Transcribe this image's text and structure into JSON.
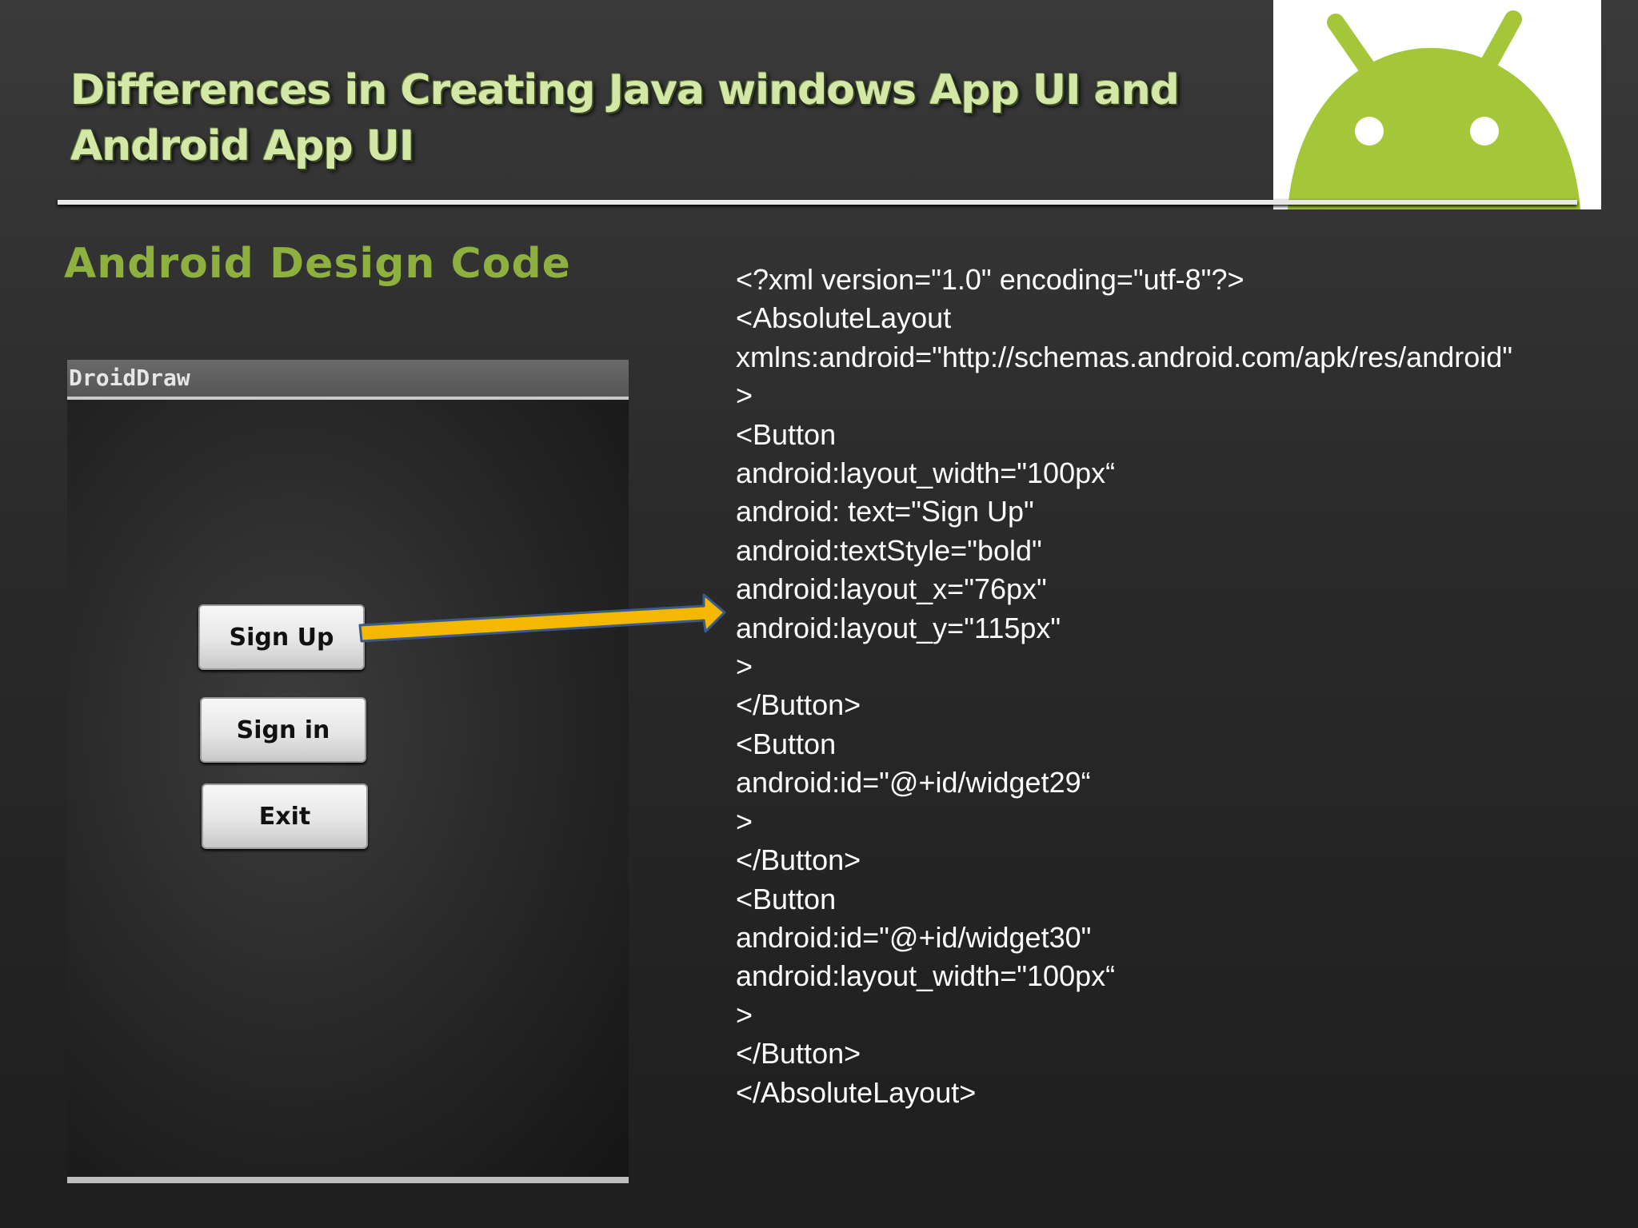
{
  "slide": {
    "title": "Differences in Creating  Java windows App UI and Android App UI",
    "section_heading": "Android Design Code",
    "brand_color": "#8db03f"
  },
  "droiddraw": {
    "window_title": "DroidDraw",
    "buttons": [
      {
        "label": "Sign Up"
      },
      {
        "label": "Sign in"
      },
      {
        "label": "Exit"
      }
    ]
  },
  "arrow": {
    "color": "#f5b800",
    "icon": "arrow-right-icon"
  },
  "code": {
    "lines": [
      "<?xml version=\"1.0\" encoding=\"utf-8\"?>",
      "<AbsoluteLayout",
      "xmlns:android=\"http://schemas.android.com/apk/res/android\"",
      ">",
      "<Button",
      "android:layout_width=\"100px“",
      "android: text=\"Sign Up\"",
      "android:textStyle=\"bold\"",
      "android:layout_x=\"76px\"",
      "android:layout_y=\"115px\"",
      ">",
      "</Button>",
      "<Button",
      "android:id=\"@+id/widget29“",
      ">",
      "</Button>",
      "<Button",
      "android:id=\"@+id/widget30\"",
      "android:layout_width=\"100px“",
      ">",
      "</Button>",
      "</AbsoluteLayout>"
    ]
  }
}
